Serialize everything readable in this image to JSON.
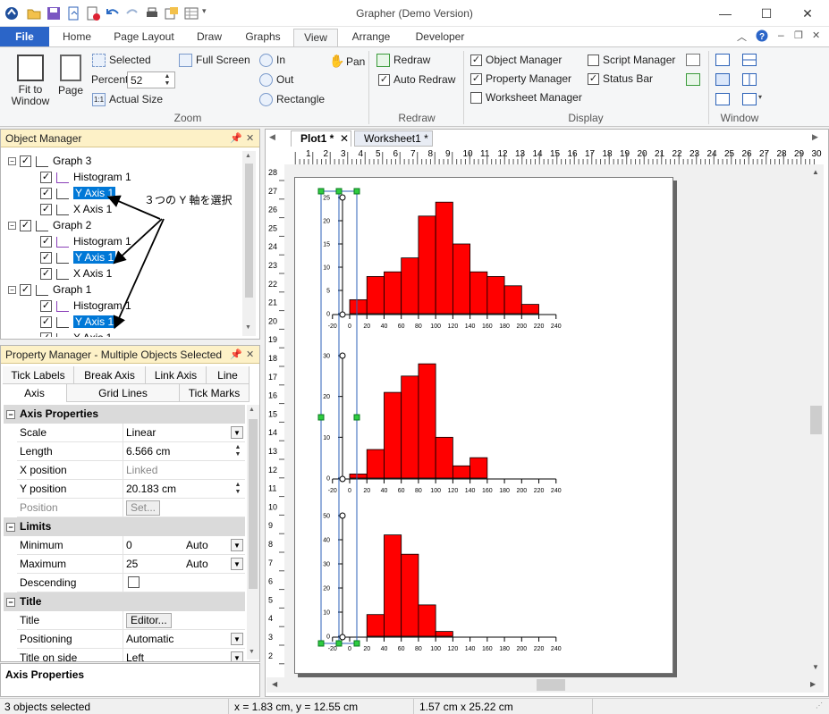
{
  "window": {
    "title": "Grapher (Demo Version)",
    "minimize": "—",
    "maximize": "☐",
    "close": "✕"
  },
  "tabs": [
    "File",
    "Home",
    "Page Layout",
    "Draw",
    "Graphs",
    "View",
    "Arrange",
    "Developer"
  ],
  "ribbon": {
    "zoom": {
      "fit_to_window": "Fit to\nWindow",
      "page": "Page",
      "selected": "Selected",
      "full_screen": "Full Screen",
      "percent_label": "Percent",
      "percent_value": "52",
      "actual_size": "Actual Size",
      "group": "Zoom",
      "in": "In",
      "out": "Out",
      "rectangle": "Rectangle",
      "pan": "Pan"
    },
    "redraw": {
      "redraw": "Redraw",
      "auto_redraw": "Auto Redraw",
      "group": "Redraw"
    },
    "display": {
      "object_manager": "Object Manager",
      "property_manager": "Property Manager",
      "worksheet_manager": "Worksheet Manager",
      "script_manager": "Script Manager",
      "status_bar": "Status Bar",
      "group": "Display"
    },
    "window": {
      "group": "Window"
    }
  },
  "object_manager": {
    "title": "Object Manager",
    "annotation": "３つの Y 軸を選択",
    "items": [
      {
        "label": "Graph 3",
        "level": 0
      },
      {
        "label": "Histogram 1",
        "level": 1
      },
      {
        "label": "Y Axis 1",
        "level": 1,
        "selected": true
      },
      {
        "label": "X Axis 1",
        "level": 1
      },
      {
        "label": "Graph 2",
        "level": 0
      },
      {
        "label": "Histogram 1",
        "level": 1
      },
      {
        "label": "Y Axis 1",
        "level": 1,
        "selected": true
      },
      {
        "label": "X Axis 1",
        "level": 1
      },
      {
        "label": "Graph 1",
        "level": 0
      },
      {
        "label": "Histogram 1",
        "level": 1
      },
      {
        "label": "Y Axis 1",
        "level": 1,
        "selected": true
      },
      {
        "label": "X Axis 1",
        "level": 1
      }
    ]
  },
  "property_manager": {
    "title": "Property Manager - Multiple Objects Selected",
    "tabs_row1": [
      "Tick Labels",
      "Break Axis",
      "Link Axis",
      "Line"
    ],
    "tabs_row2": [
      "Axis",
      "Grid Lines",
      "Tick Marks"
    ],
    "sections": {
      "axis_properties": "Axis Properties",
      "limits": "Limits",
      "title": "Title"
    },
    "rows": {
      "scale": {
        "k": "Scale",
        "v": "Linear"
      },
      "length": {
        "k": "Length",
        "v": "6.566 cm"
      },
      "x_position": {
        "k": "X position",
        "v": "Linked"
      },
      "y_position": {
        "k": "Y position",
        "v": "20.183 cm"
      },
      "position": {
        "k": "Position",
        "v": "Set..."
      },
      "minimum": {
        "k": "Minimum",
        "v": "0",
        "auto": "Auto"
      },
      "maximum": {
        "k": "Maximum",
        "v": "25",
        "auto": "Auto"
      },
      "descending": {
        "k": "Descending",
        "v": ""
      },
      "title_row": {
        "k": "Title",
        "v": "Editor..."
      },
      "positioning": {
        "k": "Positioning",
        "v": "Automatic"
      },
      "title_on_side": {
        "k": "Title on side",
        "v": "Left"
      }
    },
    "help_title": "Axis Properties"
  },
  "document": {
    "tabs": [
      "Plot1 *",
      "Worksheet1 *"
    ],
    "ruler_h": [
      "1",
      "2",
      "3",
      "4",
      "5",
      "6",
      "7",
      "8",
      "9",
      "10",
      "11",
      "12",
      "13",
      "14",
      "15",
      "16",
      "17",
      "18",
      "19",
      "20",
      "21",
      "22",
      "23",
      "24",
      "25",
      "26",
      "27",
      "28",
      "29",
      "30"
    ],
    "ruler_v": [
      "28",
      "27",
      "26",
      "25",
      "24",
      "23",
      "22",
      "21",
      "20",
      "19",
      "18",
      "17",
      "16",
      "15",
      "14",
      "13",
      "12",
      "11",
      "10",
      "9",
      "8",
      "7",
      "6",
      "5",
      "4",
      "3",
      "2"
    ]
  },
  "status": {
    "selection": "3 objects selected",
    "coords": "x = 1.83 cm, y = 12.55 cm",
    "size": "1.57 cm x 25.22 cm"
  },
  "chart_data": [
    {
      "type": "bar",
      "x": [
        0,
        20,
        40,
        60,
        80,
        100,
        120,
        140,
        160,
        180,
        200
      ],
      "bin_width": 20,
      "values": [
        3,
        8,
        9,
        12,
        21,
        24,
        15,
        9,
        8,
        6,
        2
      ],
      "xticks": [
        "-20",
        "0",
        "20",
        "40",
        "60",
        "80",
        "100",
        "120",
        "140",
        "160",
        "180",
        "200",
        "220",
        "240"
      ],
      "yticks": [
        "0",
        "5",
        "10",
        "15",
        "20",
        "25"
      ],
      "xlim": [
        -20,
        240
      ],
      "ylim": [
        0,
        25
      ]
    },
    {
      "type": "bar",
      "x": [
        0,
        20,
        40,
        60,
        80,
        100,
        120,
        140
      ],
      "bin_width": 20,
      "values": [
        1,
        7,
        21,
        25,
        28,
        10,
        3,
        5
      ],
      "xticks": [
        "-20",
        "0",
        "20",
        "40",
        "60",
        "80",
        "100",
        "120",
        "140",
        "160",
        "180",
        "200",
        "220",
        "240"
      ],
      "yticks": [
        "0",
        "10",
        "20",
        "30"
      ],
      "xlim": [
        -20,
        240
      ],
      "ylim": [
        0,
        30
      ]
    },
    {
      "type": "bar",
      "x": [
        20,
        40,
        60,
        80,
        100
      ],
      "bin_width": 20,
      "values": [
        9,
        42,
        34,
        13,
        2
      ],
      "xticks": [
        "-20",
        "0",
        "20",
        "40",
        "60",
        "80",
        "100",
        "120",
        "140",
        "160",
        "180",
        "200",
        "220",
        "240"
      ],
      "yticks": [
        "0",
        "10",
        "20",
        "30",
        "40",
        "50"
      ],
      "xlim": [
        -20,
        240
      ],
      "ylim": [
        0,
        50
      ]
    }
  ]
}
